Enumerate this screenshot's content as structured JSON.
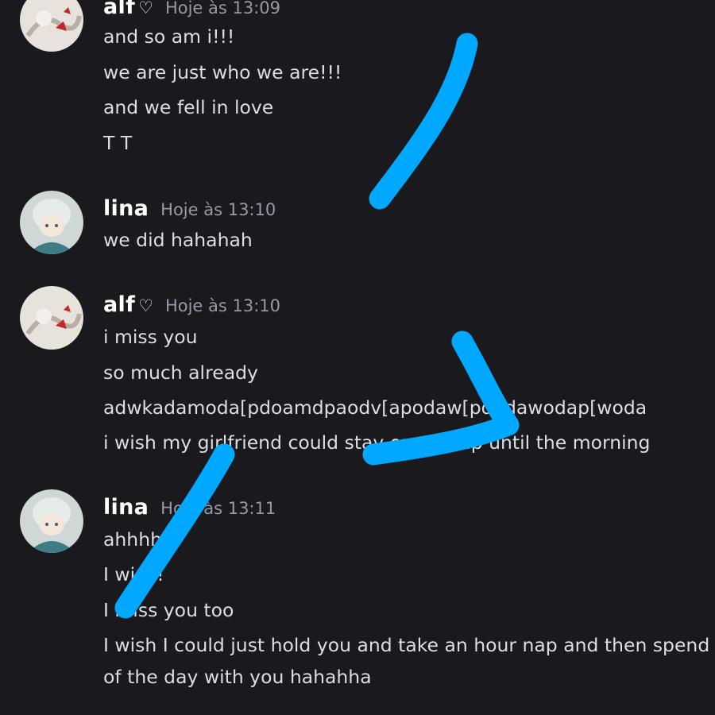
{
  "messages": [
    {
      "author": "alf",
      "badge_icon": "heart-icon",
      "timestamp": "Hoje às 13:09",
      "lines": [
        "and so am i!!!",
        "we are just who we are!!!",
        "and we fell in love",
        "T T"
      ]
    },
    {
      "author": "lina",
      "timestamp": "Hoje às 13:10",
      "lines": [
        "we did hahahah"
      ]
    },
    {
      "author": "alf",
      "badge_icon": "heart-icon",
      "timestamp": "Hoje às 13:10",
      "lines": [
        "i miss you",
        "so much already",
        "adwkadamoda[pdoamdpaodv[apodaw[pdadawodap[woda",
        "i wish my girlfriend could stay on my lap until the morning"
      ]
    },
    {
      "author": "lina",
      "timestamp": "Hoje às 13:11",
      "lines": [
        "ahhhh",
        "I wish!",
        "I miss you too",
        "I wish I could just hold you and take an hour nap and then spend the rest",
        "of the day with you hahahha"
      ]
    }
  ],
  "colors": {
    "background": "#1a1a1e",
    "username": "#ffffff",
    "timestamp": "#949ba4",
    "message_text": "#dbdee1",
    "annotation_stroke": "#00a8ff"
  }
}
